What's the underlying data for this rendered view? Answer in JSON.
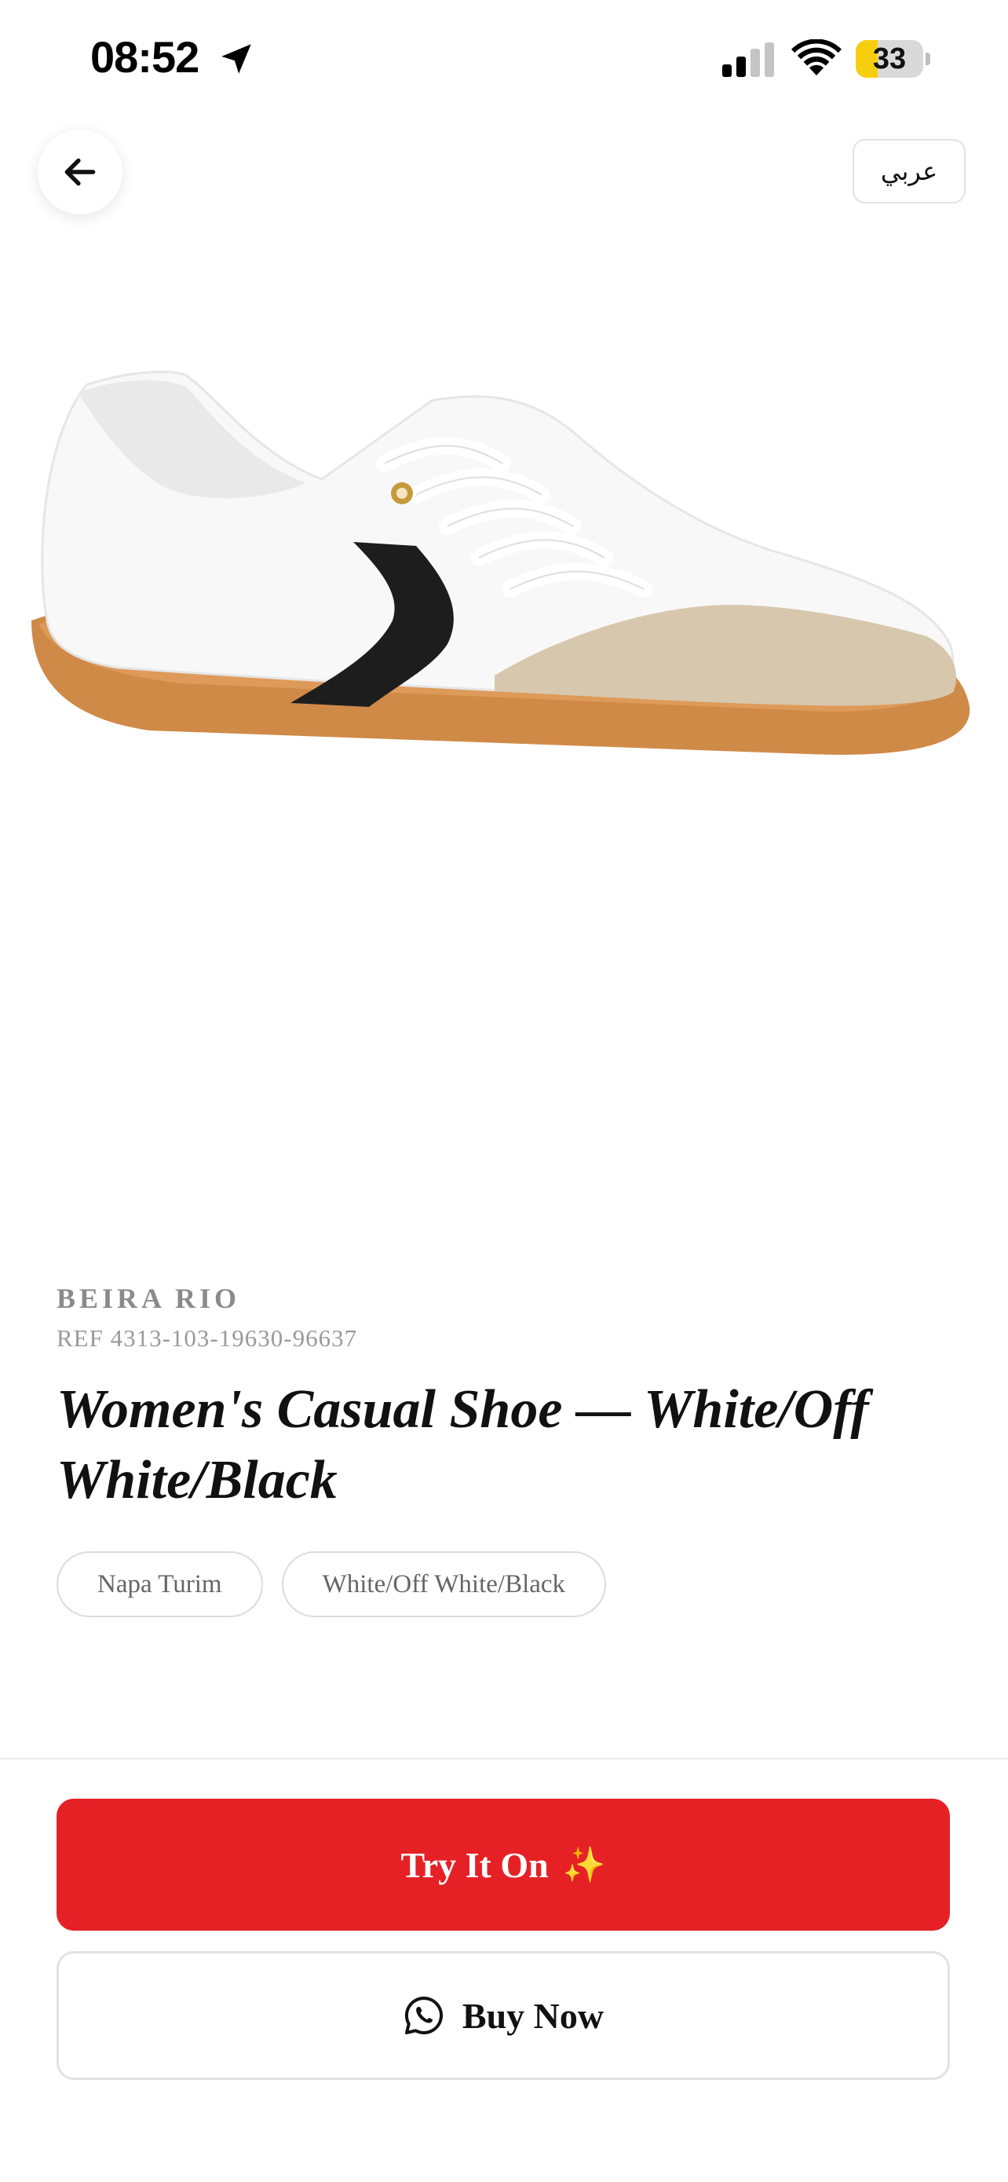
{
  "status_bar": {
    "time": "08:52",
    "battery": "33",
    "battery_level": 0.33,
    "icons": [
      "location-arrow-icon",
      "cellular-signal-icon",
      "wifi-icon",
      "battery-icon"
    ]
  },
  "header": {
    "back_icon": "arrow-left-icon",
    "language_label": "عربي"
  },
  "product": {
    "image_icon": "sneaker-photo",
    "brand": "BEIRA RIO",
    "ref": "REF 4313-103-19630-96637",
    "title": "Women's Casual Shoe — White/Off White/Black",
    "chips": [
      "Napa Turim",
      "White/Off White/Black"
    ]
  },
  "actions": {
    "try_label": "Try It On",
    "try_icon": "✨",
    "buy_label": "Buy Now",
    "buy_icon": "whatsapp-icon"
  },
  "colors": {
    "primary_red": "#e52126",
    "text_dark": "#111111",
    "text_muted": "#8a8a8a",
    "border": "#e2e2e2",
    "battery_yellow": "#f7ce0e"
  }
}
